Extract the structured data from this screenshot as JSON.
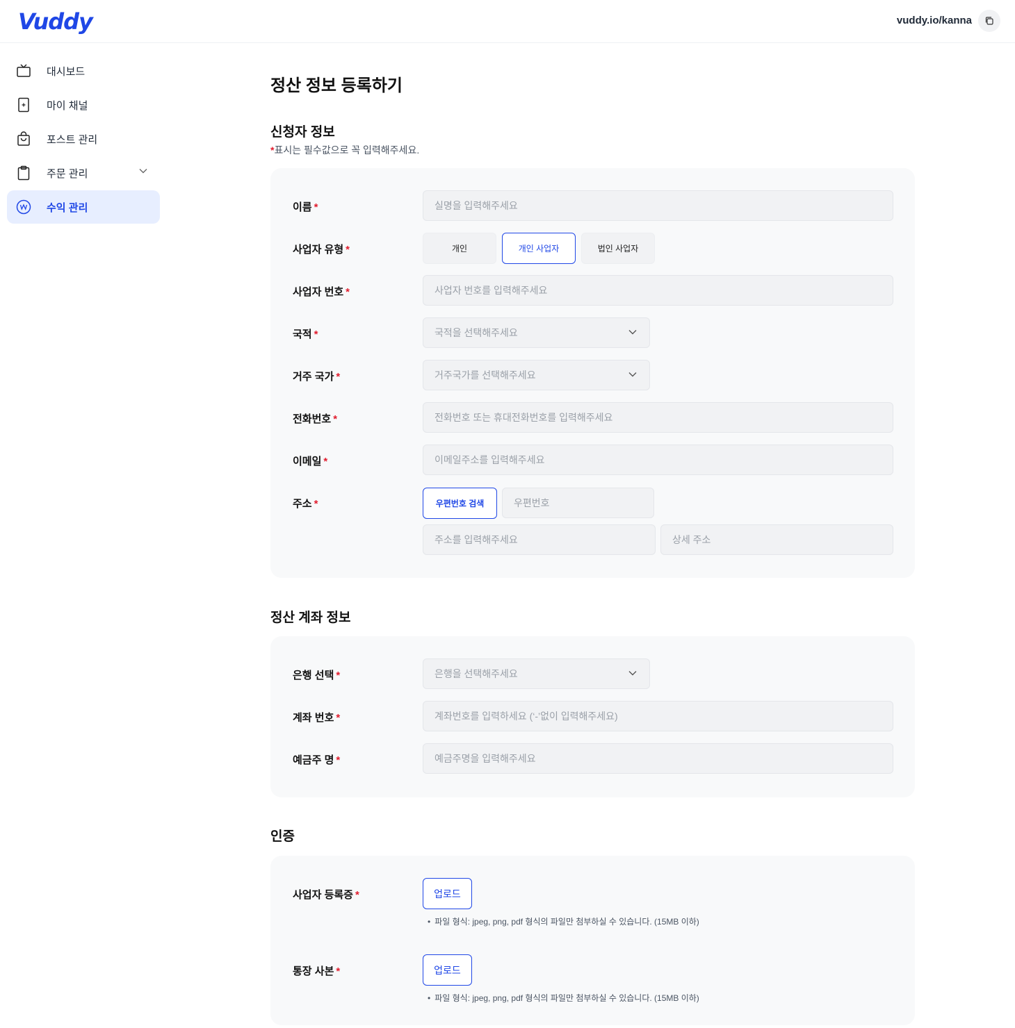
{
  "header": {
    "logo": "Vuddy",
    "profile_url": "vuddy.io/kanna"
  },
  "sidebar": {
    "items": [
      {
        "label": "대시보드",
        "icon": "tv-icon"
      },
      {
        "label": "마이 채널",
        "icon": "channel-icon"
      },
      {
        "label": "포스트 관리",
        "icon": "shopping-bag-icon"
      },
      {
        "label": "주문 관리",
        "icon": "clipboard-icon"
      },
      {
        "label": "수익 관리",
        "icon": "won-icon",
        "active": true
      }
    ]
  },
  "page": {
    "title": "정산 정보 등록하기"
  },
  "applicant": {
    "title": "신청자 정보",
    "required_star": "*",
    "required_note": "표시는 필수값으로 꼭 입력해주세요.",
    "fields": {
      "name": {
        "label": "이름",
        "placeholder": "실명을 입력해주세요"
      },
      "business_type": {
        "label": "사업자 유형",
        "options": [
          "개인",
          "개인 사업자",
          "법인 사업자"
        ],
        "selected": "개인 사업자"
      },
      "business_number": {
        "label": "사업자 번호",
        "placeholder": "사업자 번호를 입력해주세요"
      },
      "nationality": {
        "label": "국적",
        "placeholder": "국적을 선택해주세요"
      },
      "residence": {
        "label": "거주 국가",
        "placeholder": "거주국가를 선택해주세요"
      },
      "phone": {
        "label": "전화번호",
        "placeholder": "전화번호 또는 휴대전화번호를 입력해주세요"
      },
      "email": {
        "label": "이메일",
        "placeholder": "이메일주소를 입력해주세요"
      },
      "address": {
        "label": "주소",
        "search_button": "우편번호 검색",
        "postcode_placeholder": "우편번호",
        "address_placeholder": "주소를 입력해주세요",
        "detail_placeholder": "상세 주소"
      }
    }
  },
  "account": {
    "title": "정산 계좌 정보",
    "fields": {
      "bank": {
        "label": "은행 선택",
        "placeholder": "은행을 선택해주세요"
      },
      "account_number": {
        "label": "계좌 번호",
        "placeholder": "계좌번호를 입력하세요 (‘-’없이 입력해주세요)"
      },
      "holder": {
        "label": "예금주 명",
        "placeholder": "예금주명을 입력해주세요"
      }
    }
  },
  "verification": {
    "title": "인증",
    "items": [
      {
        "label": "사업자 등록증",
        "button": "업로드",
        "hint": "파일 형식: jpeg, png, pdf 형식의 파일만 첨부하실 수 있습니다. (15MB 이하)"
      },
      {
        "label": "통장 사본",
        "button": "업로드",
        "hint": "파일 형식: jpeg, png, pdf 형식의 파일만 첨부하실 수 있습니다. (15MB 이하)"
      }
    ]
  },
  "common": {
    "star": "*",
    "bullet": "•"
  },
  "colors": {
    "brand": "#1f47e6",
    "required": "#e11d2e",
    "active_nav_bg": "#e7eeff",
    "card_bg": "#f8f9fa",
    "input_bg": "#f1f2f4"
  }
}
